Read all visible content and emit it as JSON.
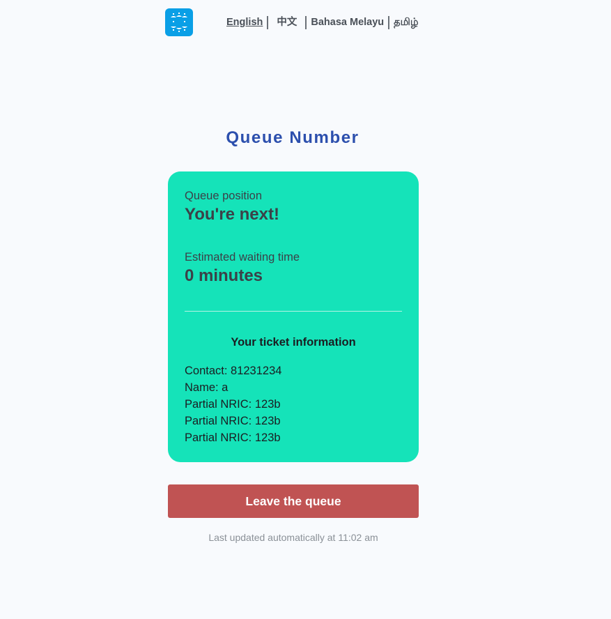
{
  "header": {
    "logo_icon": "queue-faces-logo-icon",
    "languages": [
      {
        "label": "English",
        "active": true
      },
      {
        "label": "中文",
        "active": false
      },
      {
        "label": "Bahasa Melayu",
        "active": false
      },
      {
        "label": "தமிழ்",
        "active": false
      }
    ]
  },
  "page_title": "Queue Number",
  "card": {
    "position_label": "Queue position",
    "position_value": "You're next!",
    "wait_label": "Estimated waiting time",
    "wait_value": "0 minutes",
    "ticket_heading": "Your ticket information",
    "ticket_lines": [
      "Contact: 81231234",
      "Name: a",
      "Partial NRIC: 123b",
      "Partial NRIC: 123b",
      "Partial NRIC: 123b"
    ]
  },
  "leave_button_label": "Leave the queue",
  "last_updated": "Last updated automatically at 11:02 am",
  "colors": {
    "background": "#f8fafd",
    "title": "#2c4fad",
    "card": "#15e3b9",
    "leave_button": "#c05353",
    "logo": "#0a9fe6"
  }
}
